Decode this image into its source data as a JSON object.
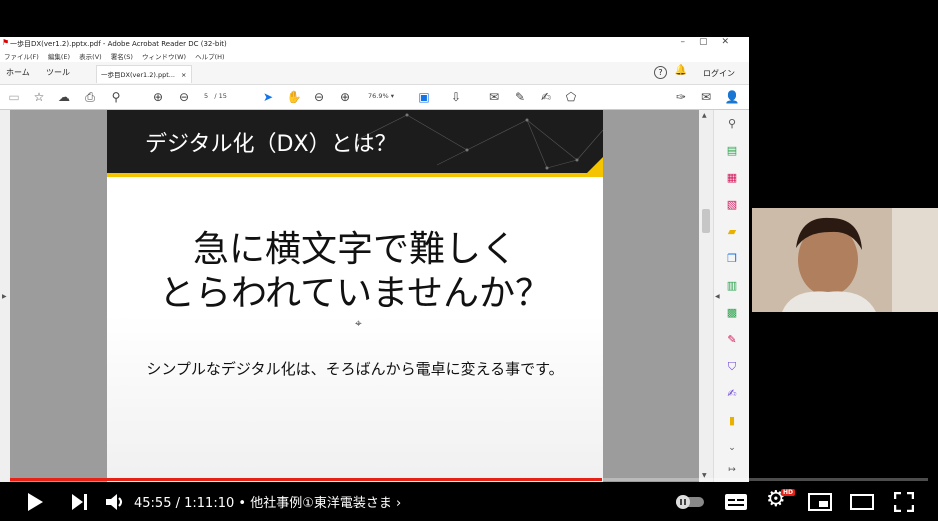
{
  "acrobat": {
    "title": "一歩目DX(ver1.2).pptx.pdf - Adobe Acrobat Reader DC (32-bit)",
    "menu": [
      "ファイル(F)",
      "編集(E)",
      "表示(V)",
      "署名(S)",
      "ウィンドウ(W)",
      "ヘルプ(H)"
    ],
    "tabs": {
      "home": "ホーム",
      "tools": "ツール",
      "doc": "一歩目DX(ver1.2).ppt...",
      "doc_close": "×"
    },
    "login": "ログイン",
    "page": {
      "current": "5",
      "separator": "/",
      "total": "15"
    },
    "zoom": "76.9%"
  },
  "slide": {
    "title": "デジタル化（DX）とは？",
    "main_line1": "急に横文字で難しく",
    "main_line2": "とらわれていませんか？",
    "subtitle": "シンプルなデジタル化は、そろばんから電卓に変える事です。",
    "accent_color": "#f5c400"
  },
  "player": {
    "current_time": "45:55",
    "duration": "1:11:10",
    "chapter": "他社事例①東洋電装さま",
    "progress": 0.645,
    "hd_badge": "HD"
  }
}
